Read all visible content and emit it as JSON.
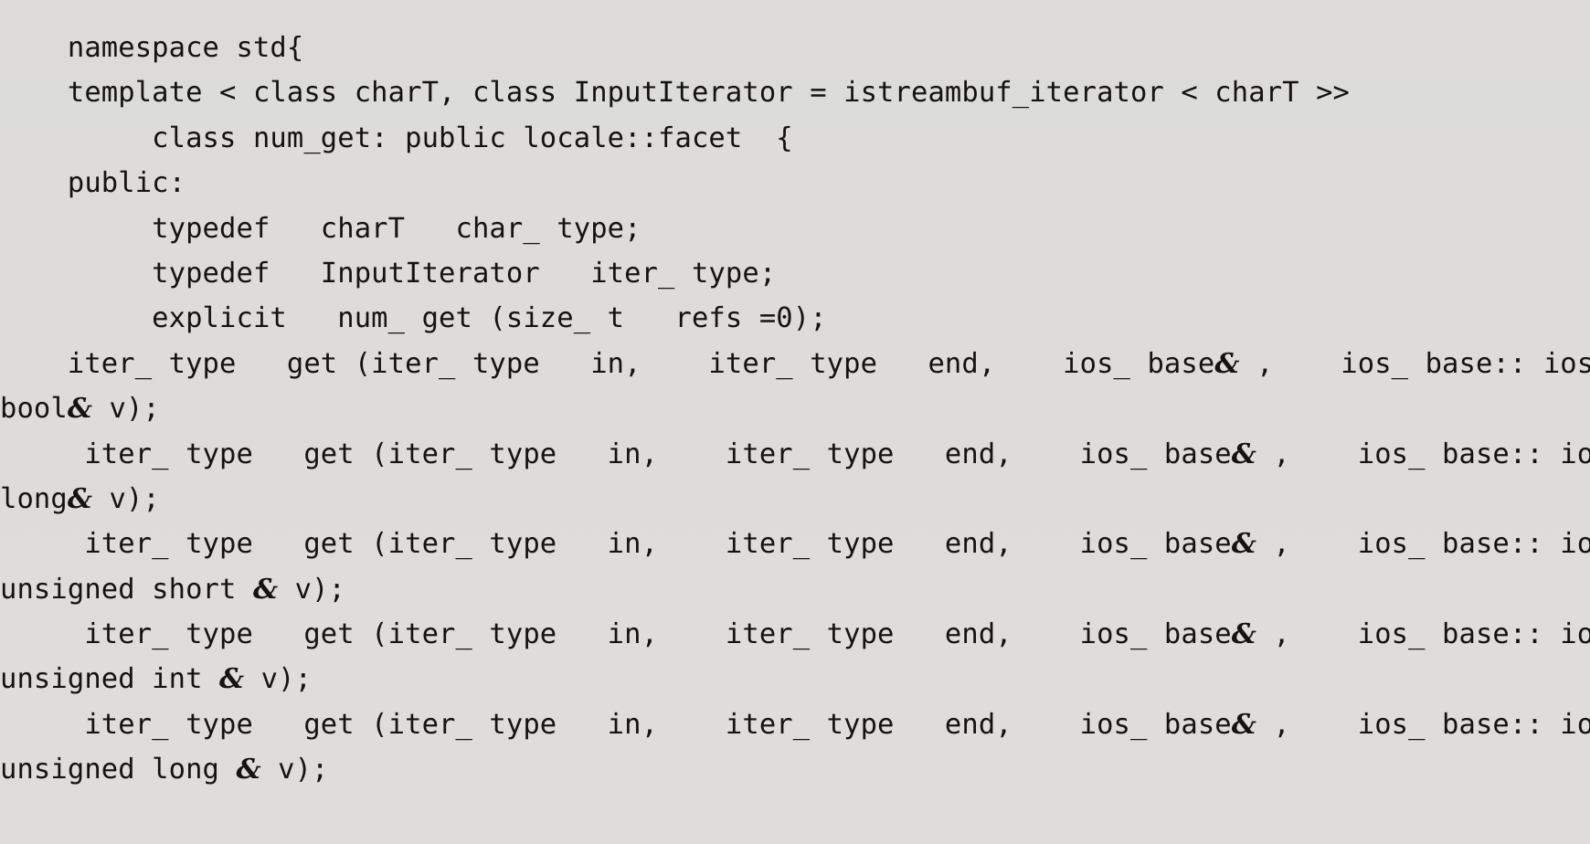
{
  "document": {
    "kind": "scanned-code-listing",
    "language": "C++",
    "background_color": "#dedddb",
    "text_color": "#15130f"
  },
  "code": {
    "lines": [
      "    namespace std{",
      "    template < class charT, class InputIterator = istreambuf_iterator < charT >>",
      "         class num_get: public locale::facet  {",
      "    public:",
      "         typedef   charT   char_ type;",
      "         typedef   InputIterator   iter_ type;",
      "         explicit   num_ get (size_ t   refs =0);",
      "    iter_ type   get (iter_ type   in,    iter_ type   end,    ios_ base& ,    ios_ base:: iostate& err,",
      "bool& v);",
      "     iter_ type   get (iter_ type   in,    iter_ type   end,    ios_ base& ,    ios_ base:: iostate& err,",
      "long& v);",
      "     iter_ type   get (iter_ type   in,    iter_ type   end,    ios_ base& ,    ios_ base:: iostate& err,",
      "unsigned short & v);",
      "     iter_ type   get (iter_ type   in,    iter_ type   end,    ios_ base& ,    ios_ base:: iostate& err,",
      "unsigned int & v);",
      "     iter_ type   get (iter_ type   in,    iter_ type   end,    ios_ base& ,    ios_ base:: iostate& err,",
      "unsigned long & v);"
    ]
  }
}
